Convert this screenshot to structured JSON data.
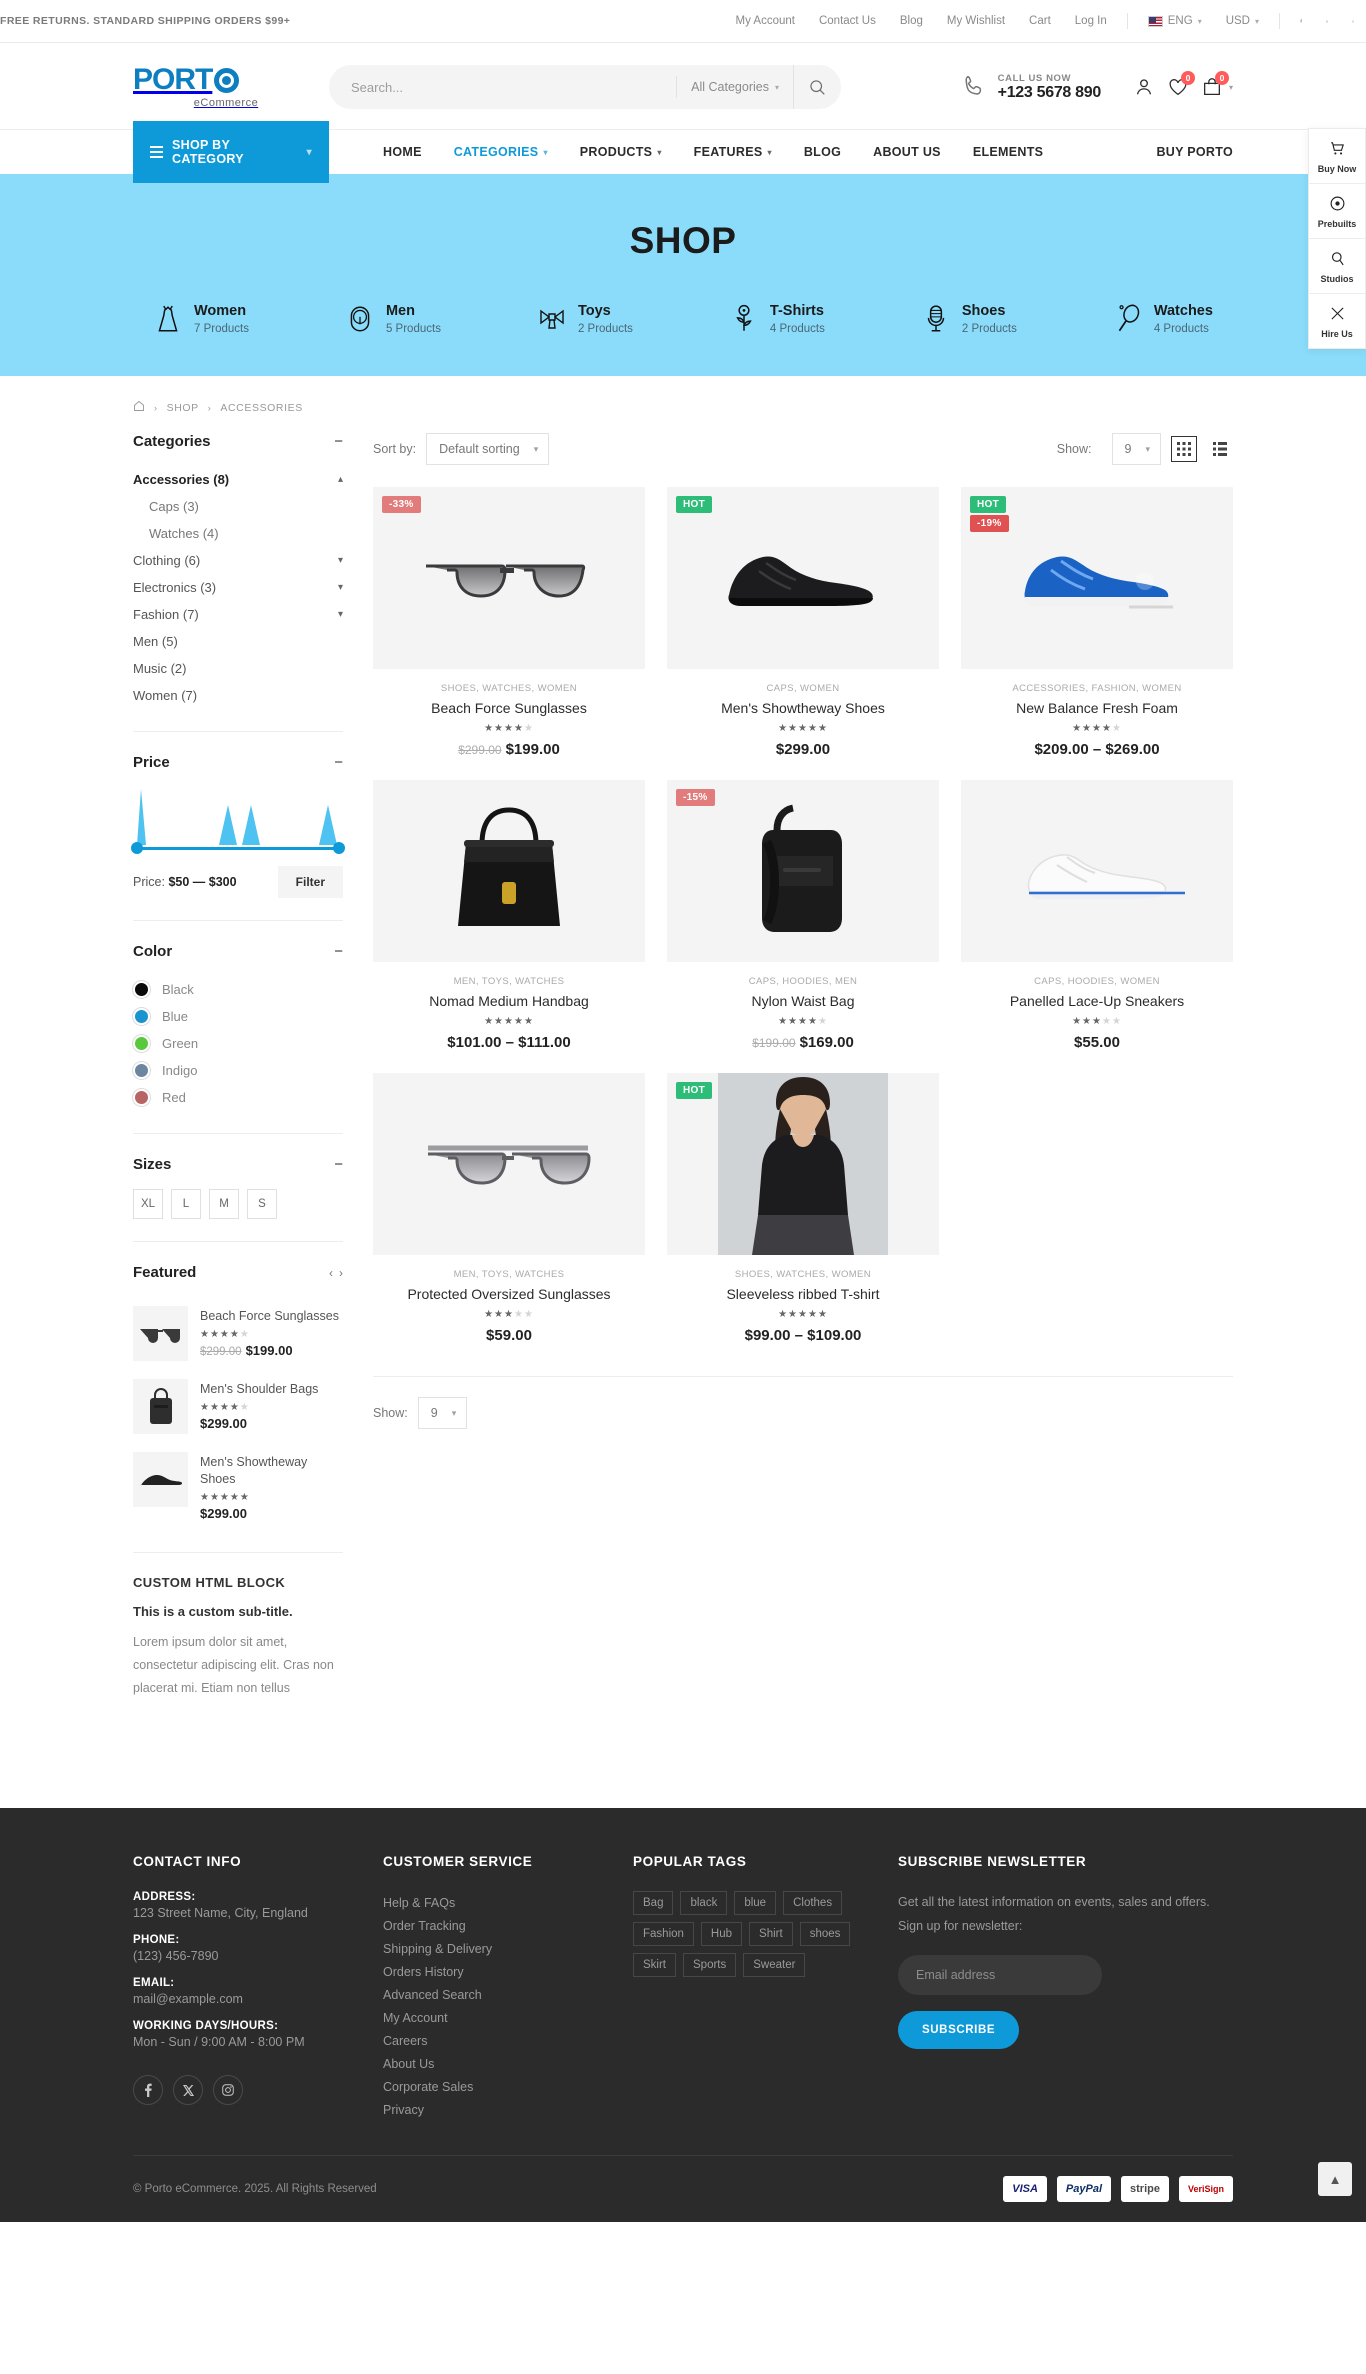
{
  "topbar": {
    "promo": "FREE RETURNS. STANDARD SHIPPING ORDERS $99+",
    "links": [
      "My Account",
      "Contact Us",
      "Blog",
      "My Wishlist",
      "Cart",
      "Log In"
    ],
    "language": "ENG",
    "currency": "USD",
    "socials": [
      "facebook-icon",
      "x-twitter-icon",
      "instagram-icon"
    ]
  },
  "header": {
    "logo_text": "PORT",
    "logo_sub": "eCommerce",
    "search_placeholder": "Search...",
    "search_value": "",
    "categories_select": "All Categories",
    "call_label": "CALL US NOW",
    "phone": "+123 5678 890",
    "wishlist_count": "0",
    "cart_count": "0"
  },
  "nav": {
    "shop_by_category": "SHOP BY CATEGORY",
    "items": [
      {
        "label": "HOME",
        "has_caret": false,
        "active": false
      },
      {
        "label": "CATEGORIES",
        "has_caret": true,
        "active": true
      },
      {
        "label": "PRODUCTS",
        "has_caret": true,
        "active": false
      },
      {
        "label": "FEATURES",
        "has_caret": true,
        "active": false
      },
      {
        "label": "BLOG",
        "has_caret": false,
        "active": false
      },
      {
        "label": "ABOUT US",
        "has_caret": false,
        "active": false
      },
      {
        "label": "ELEMENTS",
        "has_caret": false,
        "active": false
      }
    ],
    "buy_porto": "BUY PORTO"
  },
  "rail": [
    {
      "label": "Buy Now",
      "icon": "cart-icon"
    },
    {
      "label": "Prebuilts",
      "icon": "layers-icon"
    },
    {
      "label": "Studios",
      "icon": "studio-icon"
    },
    {
      "label": "Hire Us",
      "icon": "tools-icon"
    }
  ],
  "hero": {
    "title": "SHOP",
    "categories": [
      {
        "name": "Women",
        "count": "7 Products",
        "icon": "dress-icon"
      },
      {
        "name": "Men",
        "count": "5 Products",
        "icon": "gauge-icon"
      },
      {
        "name": "Toys",
        "count": "2 Products",
        "icon": "bowtie-icon"
      },
      {
        "name": "T-Shirts",
        "count": "4 Products",
        "icon": "flower-icon"
      },
      {
        "name": "Shoes",
        "count": "2 Products",
        "icon": "microphone-icon"
      },
      {
        "name": "Watches",
        "count": "4 Products",
        "icon": "racket-icon"
      }
    ]
  },
  "breadcrumb": [
    "SHOP",
    "ACCESSORIES"
  ],
  "sidebar": {
    "categories_title": "Categories",
    "categories": [
      {
        "name": "Accessories",
        "count": "(8)",
        "level": 0,
        "active": true,
        "chev": "up"
      },
      {
        "name": "Caps",
        "count": "(3)",
        "level": 1,
        "active": false,
        "chev": ""
      },
      {
        "name": "Watches",
        "count": "(4)",
        "level": 1,
        "active": false,
        "chev": ""
      },
      {
        "name": "Clothing",
        "count": "(6)",
        "level": 0,
        "active": false,
        "chev": "down"
      },
      {
        "name": "Electronics",
        "count": "(3)",
        "level": 0,
        "active": false,
        "chev": "down"
      },
      {
        "name": "Fashion",
        "count": "(7)",
        "level": 0,
        "active": false,
        "chev": "down"
      },
      {
        "name": "Men",
        "count": "(5)",
        "level": 0,
        "active": false,
        "chev": ""
      },
      {
        "name": "Music",
        "count": "(2)",
        "level": 0,
        "active": false,
        "chev": ""
      },
      {
        "name": "Women",
        "count": "(7)",
        "level": 0,
        "active": false,
        "chev": ""
      }
    ],
    "price_title": "Price",
    "price_label_prefix": "Price:",
    "price_range": "$50 — $300",
    "filter_button": "Filter",
    "color_title": "Color",
    "colors": [
      {
        "name": "Black",
        "hex": "#0a0a0a"
      },
      {
        "name": "Blue",
        "hex": "#1b93cf"
      },
      {
        "name": "Green",
        "hex": "#58c93b"
      },
      {
        "name": "Indigo",
        "hex": "#6c86a0"
      },
      {
        "name": "Red",
        "hex": "#b86464"
      }
    ],
    "sizes_title": "Sizes",
    "sizes": [
      "XL",
      "L",
      "M",
      "S"
    ],
    "featured_title": "Featured",
    "featured": [
      {
        "name": "Beach Force Sunglasses",
        "stars": 4.5,
        "old": "$299.00",
        "price": "$199.00",
        "thumb": "sunglasses"
      },
      {
        "name": "Men's Shoulder Bags",
        "stars": 4.5,
        "old": "",
        "price": "$299.00",
        "thumb": "bag"
      },
      {
        "name": "Men's Showtheway Shoes",
        "stars": 5,
        "old": "",
        "price": "$299.00",
        "thumb": "shoe"
      }
    ],
    "html_block_title": "CUSTOM HTML BLOCK",
    "html_block_sub": "This is a custom sub-title.",
    "html_block_text": "Lorem ipsum dolor sit amet, consectetur adipiscing elit. Cras non placerat mi. Etiam non tellus"
  },
  "toolbar": {
    "sort_label": "Sort by:",
    "sort_value": "Default sorting",
    "show_label": "Show:",
    "show_value": "9",
    "grid_icon": "grid-view-icon",
    "list_icon": "list-view-icon"
  },
  "bottombar": {
    "show_label": "Show:",
    "show_value": "9"
  },
  "products": [
    {
      "name": "Beach Force Sunglasses",
      "cats": "SHOES, WATCHES, WOMEN",
      "stars": 4.5,
      "old_price": "$299.00",
      "price": "$199.00",
      "badges": [
        {
          "text": "-33%",
          "type": "sale"
        }
      ],
      "image": "sunglasses-black"
    },
    {
      "name": "Men's Showtheway Shoes",
      "cats": "CAPS, WOMEN",
      "stars": 5,
      "old_price": "",
      "price": "$299.00",
      "badges": [
        {
          "text": "HOT",
          "type": "hot"
        }
      ],
      "image": "shoe-black"
    },
    {
      "name": "New Balance Fresh Foam",
      "cats": "ACCESSORIES, FASHION, WOMEN",
      "stars": 4.5,
      "old_price": "",
      "price": "$209.00 – $269.00",
      "badges": [
        {
          "text": "HOT",
          "type": "hot"
        },
        {
          "text": "-19%",
          "type": "sale"
        }
      ],
      "image": "shoe-blue"
    },
    {
      "name": "Nomad Medium Handbag",
      "cats": "MEN, TOYS, WATCHES",
      "stars": 5,
      "old_price": "",
      "price": "$101.00 – $111.00",
      "badges": [],
      "image": "handbag"
    },
    {
      "name": "Nylon Waist Bag",
      "cats": "CAPS, HOODIES, MEN",
      "stars": 4,
      "old_price": "$199.00",
      "price": "$169.00",
      "badges": [
        {
          "text": "-15%",
          "type": "sale"
        }
      ],
      "image": "waistbag"
    },
    {
      "name": "Panelled Lace-Up Sneakers",
      "cats": "CAPS, HOODIES, WOMEN",
      "stars": 3.5,
      "old_price": "",
      "price": "$55.00",
      "badges": [],
      "image": "sneaker-white"
    },
    {
      "name": "Protected Oversized Sunglasses",
      "cats": "MEN, TOYS, WATCHES",
      "stars": 3.5,
      "old_price": "",
      "price": "$59.00",
      "badges": [],
      "image": "sunglasses-silver"
    },
    {
      "name": "Sleeveless ribbed T-shirt",
      "cats": "SHOES, WATCHES, WOMEN",
      "stars": 5,
      "old_price": "",
      "price": "$99.00 – $109.00",
      "badges": [
        {
          "text": "HOT",
          "type": "hot"
        }
      ],
      "image": "tshirt-model"
    }
  ],
  "footer": {
    "contact_title": "CONTACT INFO",
    "address_label": "ADDRESS:",
    "address": "123 Street Name, City, England",
    "phone_label": "PHONE:",
    "phone": "(123) 456-7890",
    "email_label": "EMAIL:",
    "email": "mail@example.com",
    "hours_label": "WORKING DAYS/HOURS:",
    "hours": "Mon - Sun / 9:00 AM - 8:00 PM",
    "service_title": "CUSTOMER SERVICE",
    "service_links": [
      "Help & FAQs",
      "Order Tracking",
      "Shipping & Delivery",
      "Orders History",
      "Advanced Search",
      "My Account",
      "Careers",
      "About Us",
      "Corporate Sales",
      "Privacy"
    ],
    "tags_title": "POPULAR TAGS",
    "tags": [
      "Bag",
      "black",
      "blue",
      "Clothes",
      "Fashion",
      "Hub",
      "Shirt",
      "shoes",
      "Skirt",
      "Sports",
      "Sweater"
    ],
    "newsletter_title": "SUBSCRIBE NEWSLETTER",
    "newsletter_text": "Get all the latest information on events, sales and offers. Sign up for newsletter:",
    "email_placeholder": "Email address",
    "subscribe_button": "SUBSCRIBE",
    "copyright": "© Porto eCommerce. 2025. All Rights Reserved",
    "payments": [
      "VISA",
      "PayPal",
      "stripe",
      "VeriSign"
    ]
  }
}
